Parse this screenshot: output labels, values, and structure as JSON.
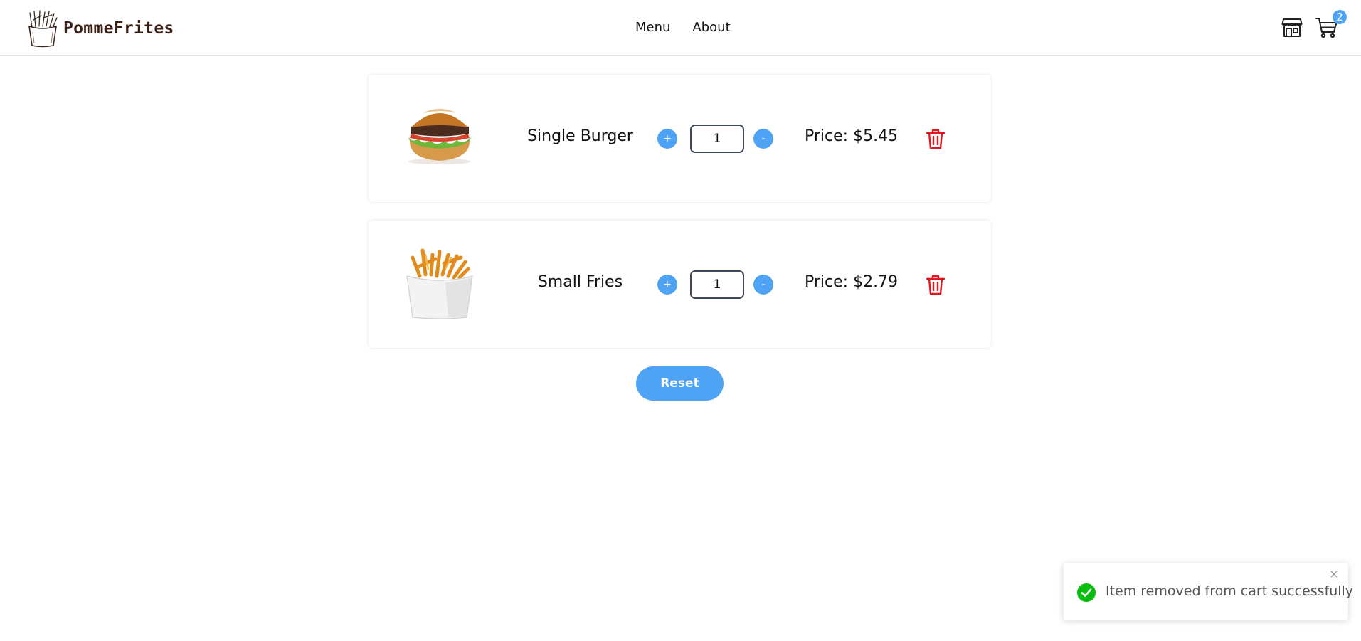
{
  "app": {
    "brand": "PommeFrites",
    "nav": [
      "Menu",
      "About"
    ],
    "cart_count": "2"
  },
  "icons": {
    "store": "store-icon",
    "cart": "shopping-cart-icon",
    "remove": "trash-icon",
    "toast_success": "check-circle-icon",
    "toast_close": "close-icon"
  },
  "cart": {
    "items": [
      {
        "name": "Single Burger",
        "increase_label": "+",
        "quantity": "1",
        "decrease_label": "-",
        "price": "Price: $5.45",
        "image": "burger-image"
      },
      {
        "name": "Small Fries",
        "increase_label": "+",
        "quantity": "1",
        "decrease_label": "-",
        "price": "Price: $2.79",
        "image": "fries-image"
      }
    ],
    "reset_label": "Reset"
  },
  "toast": {
    "message": "Item removed from cart successfully",
    "close_label": "×"
  },
  "colors": {
    "accent": "#4ea3f5",
    "danger": "#e5161d",
    "success": "#07bc0c",
    "brand_text": "#3a1f14"
  }
}
